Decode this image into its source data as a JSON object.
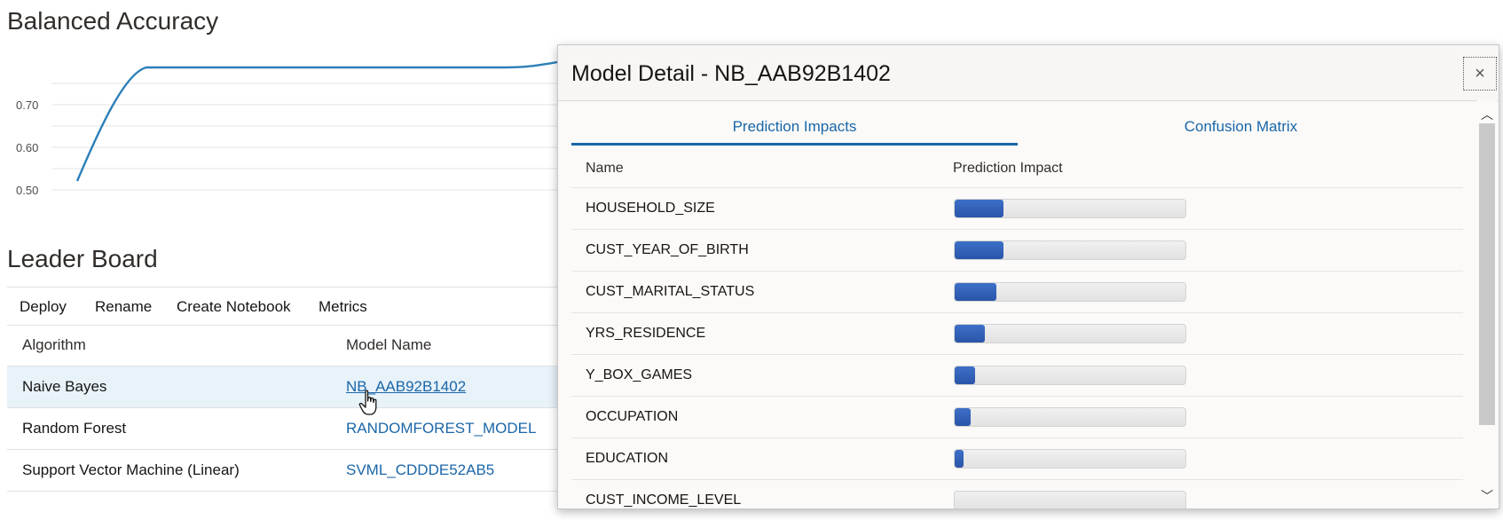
{
  "balanced_accuracy": {
    "title": "Balanced Accuracy",
    "y_ticks": [
      "0.70",
      "0.60",
      "0.50"
    ],
    "series_color": "#2b7fb8"
  },
  "leader_board": {
    "title": "Leader Board",
    "toolbar": {
      "deploy": "Deploy",
      "rename": "Rename",
      "create_notebook": "Create Notebook",
      "metrics": "Metrics"
    },
    "columns": {
      "algorithm": "Algorithm",
      "model_name": "Model Name"
    },
    "rows": [
      {
        "algorithm": "Naive Bayes",
        "model_name": "NB_AAB92B1402"
      },
      {
        "algorithm": "Random Forest",
        "model_name": "RANDOMFOREST_MODEL"
      },
      {
        "algorithm": "Support Vector Machine (Linear)",
        "model_name": "SVML_CDDDE52AB5"
      }
    ]
  },
  "dialog": {
    "title": "Model Detail - NB_AAB92B1402",
    "close_icon": "×",
    "tabs": {
      "prediction_impacts": "Prediction Impacts",
      "confusion_matrix": "Confusion Matrix"
    },
    "table": {
      "name_header": "Name",
      "impact_header": "Prediction Impact",
      "rows": [
        {
          "name": "HOUSEHOLD_SIZE",
          "impact_pct": 21
        },
        {
          "name": "CUST_YEAR_OF_BIRTH",
          "impact_pct": 21
        },
        {
          "name": "CUST_MARITAL_STATUS",
          "impact_pct": 18
        },
        {
          "name": "YRS_RESIDENCE",
          "impact_pct": 13
        },
        {
          "name": "Y_BOX_GAMES",
          "impact_pct": 9
        },
        {
          "name": "OCCUPATION",
          "impact_pct": 7
        },
        {
          "name": "EDUCATION",
          "impact_pct": 4
        },
        {
          "name": "CUST_INCOME_LEVEL",
          "impact_pct": 0
        }
      ]
    },
    "scroll_up_icon": "︿",
    "scroll_down_icon": "﹀"
  }
}
